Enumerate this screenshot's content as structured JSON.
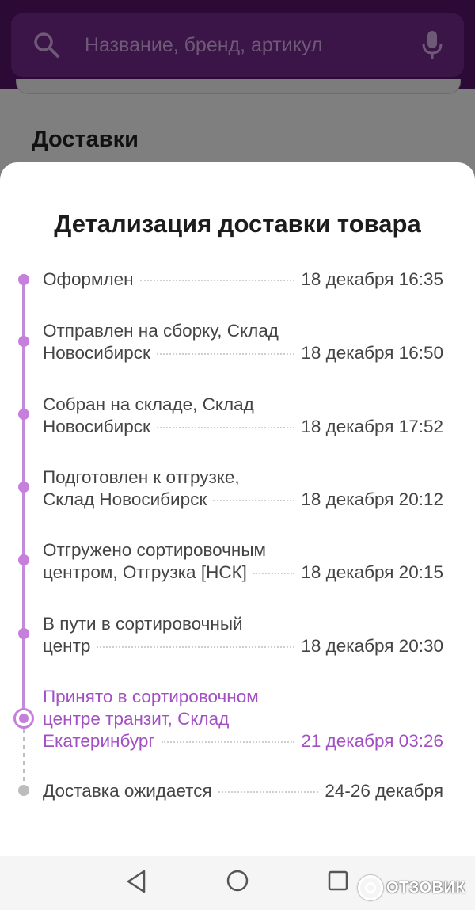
{
  "search": {
    "placeholder": "Название, бренд, артикул",
    "icon": "search-icon",
    "mic_icon": "microphone-icon"
  },
  "background": {
    "heading": "Доставки"
  },
  "sheet": {
    "title": "Детализация доставки товара",
    "steps": [
      {
        "lines": [
          "Оформлен"
        ],
        "date": "18 декабря 16:35",
        "state": "done"
      },
      {
        "lines": [
          "Отправлен на сборку, Склад",
          "Новосибирск"
        ],
        "date": "18 декабря 16:50",
        "state": "done"
      },
      {
        "lines": [
          "Собран на складе, Склад",
          "Новосибирск"
        ],
        "date": "18 декабря 17:52",
        "state": "done"
      },
      {
        "lines": [
          "Подготовлен к отгрузке,",
          "Склад Новосибирск"
        ],
        "date": "18 декабря 20:12",
        "state": "done"
      },
      {
        "lines": [
          "Отгружено сортировочным",
          "центром, Отгрузка [НСК]"
        ],
        "date": "18 декабря 20:15",
        "state": "done"
      },
      {
        "lines": [
          "В пути в сортировочный",
          "центр"
        ],
        "date": "18 декабря 20:30",
        "state": "done"
      },
      {
        "lines": [
          "Принято в сортировочном",
          "центре транзит, Склад",
          "Екатеринбург"
        ],
        "date": "21 декабря 03:26",
        "state": "current"
      },
      {
        "lines": [
          "Доставка ожидается"
        ],
        "date": "24-26 декабря",
        "state": "pending"
      }
    ],
    "colors": {
      "accent": "#a34fc4",
      "timeline": "#c67fdc",
      "pending": "#bdbdbd"
    }
  },
  "navbar": {
    "back_icon": "back-triangle-icon",
    "home_icon": "home-circle-icon",
    "recents_icon": "recents-square-icon"
  },
  "watermark": {
    "text": "ОТЗОВИК"
  }
}
